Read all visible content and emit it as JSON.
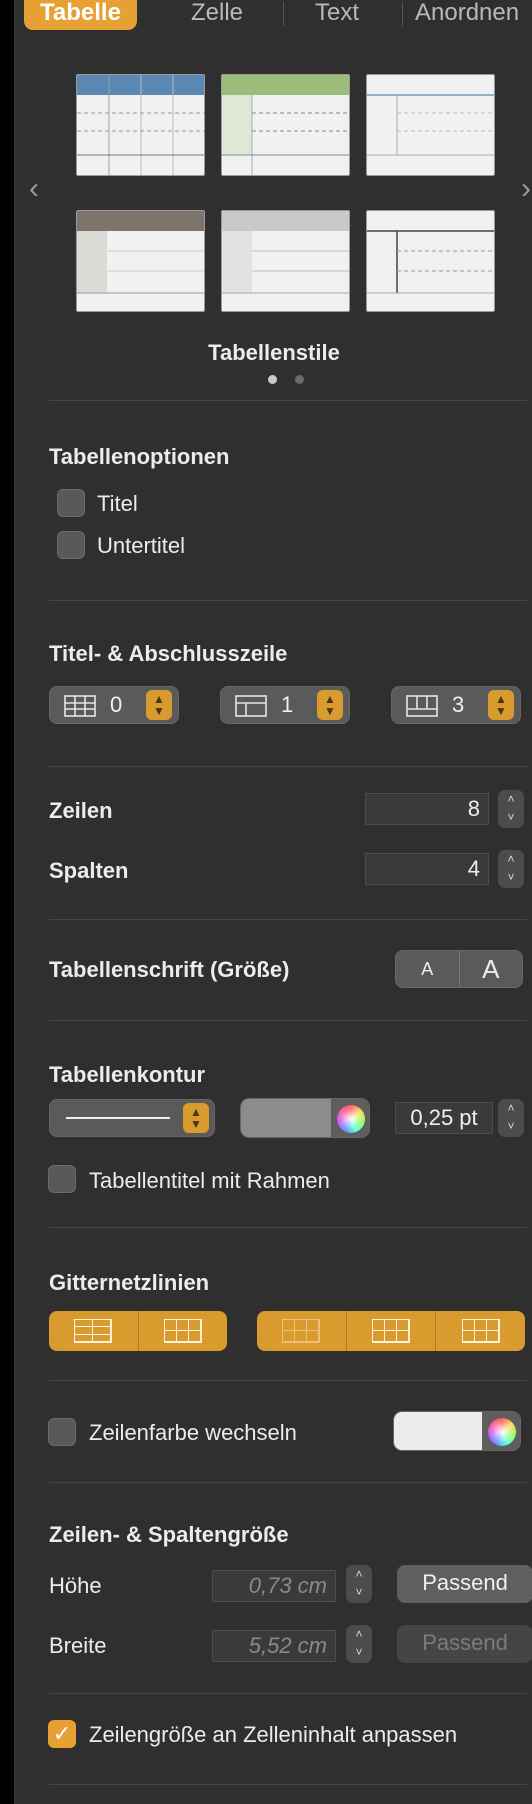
{
  "tabs": [
    {
      "label": "Tabelle",
      "active": true
    },
    {
      "label": "Zelle",
      "active": false
    },
    {
      "label": "Text",
      "active": false
    },
    {
      "label": "Anordnen",
      "active": false
    }
  ],
  "styles_section": {
    "label": "Tabellenstile",
    "page_dots": 2,
    "active_dot": 1
  },
  "options": {
    "heading": "Tabellenoptionen",
    "title_checkbox": {
      "label": "Titel",
      "checked": false
    },
    "subtitle_checkbox": {
      "label": "Untertitel",
      "checked": false
    }
  },
  "header_footer": {
    "heading": "Titel- & Abschlusszeile",
    "header_rows": "0",
    "header_columns": "1",
    "footer_rows": "3"
  },
  "rows_columns": {
    "rows_label": "Zeilen",
    "rows_value": "8",
    "columns_label": "Spalten",
    "columns_value": "4"
  },
  "font_size": {
    "label": "Tabellenschrift (Größe)",
    "smaller": "A",
    "larger": "A"
  },
  "outline": {
    "heading": "Tabellenkontur",
    "width_value": "0,25 pt",
    "color": "#8c8c8c",
    "title_border": {
      "label": "Tabellentitel mit Rahmen",
      "checked": false
    }
  },
  "gridlines": {
    "heading": "Gitternetzlinien"
  },
  "alternating": {
    "label": "Zeilenfarbe wechseln",
    "checked": false,
    "color": "#ececec"
  },
  "size": {
    "heading": "Zeilen- & Spaltengröße",
    "height_label": "Höhe",
    "height_value": "0,73 cm",
    "height_fit": "Passend",
    "width_label": "Breite",
    "width_value": "5,52 cm",
    "width_fit": "Passend",
    "auto_fit": {
      "label": "Zeilengröße an Zelleninhalt anpassen",
      "checked": true
    }
  },
  "colors": {
    "accent": "#e7a033",
    "panel_bg": "#2f2f2f"
  }
}
